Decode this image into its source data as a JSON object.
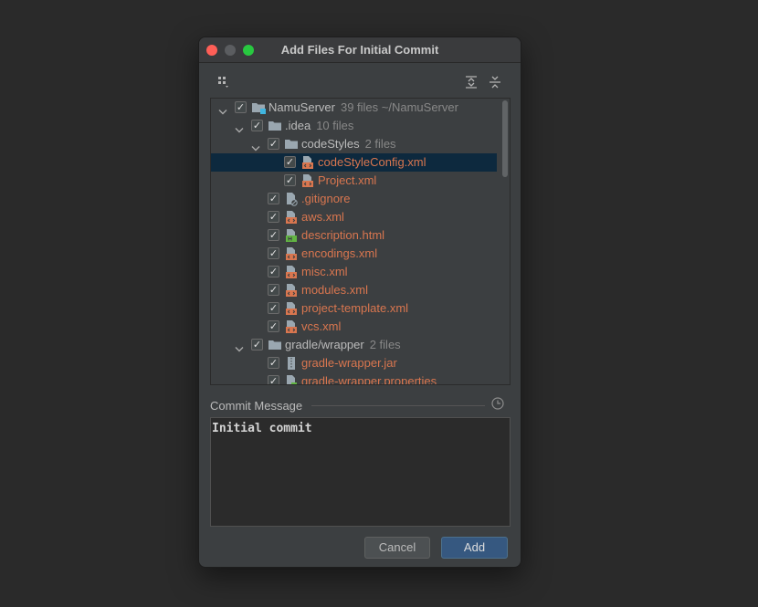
{
  "window": {
    "title": "Add Files For Initial Commit"
  },
  "toolbar": {
    "group_icon": "group-by-icon",
    "expand_icon": "expand-all-icon",
    "collapse_icon": "collapse-all-icon"
  },
  "tree": [
    {
      "name": "NamuServer",
      "meta": "39 files  ~/NamuServer",
      "kind": "module",
      "depth": 0,
      "expanded": true,
      "checked": true
    },
    {
      "name": ".idea",
      "meta": "10 files",
      "kind": "folder",
      "depth": 1,
      "expanded": true,
      "checked": true
    },
    {
      "name": "codeStyles",
      "meta": "2 files",
      "kind": "folder",
      "depth": 2,
      "expanded": true,
      "checked": true
    },
    {
      "name": "codeStyleConfig.xml",
      "kind": "xml",
      "depth": 3,
      "checked": true,
      "selected": true
    },
    {
      "name": "Project.xml",
      "kind": "xml",
      "depth": 3,
      "checked": true
    },
    {
      "name": ".gitignore",
      "kind": "ignore",
      "depth": 2,
      "checked": true
    },
    {
      "name": "aws.xml",
      "kind": "xml",
      "depth": 2,
      "checked": true
    },
    {
      "name": "description.html",
      "kind": "html",
      "depth": 2,
      "checked": true
    },
    {
      "name": "encodings.xml",
      "kind": "xml",
      "depth": 2,
      "checked": true
    },
    {
      "name": "misc.xml",
      "kind": "xml",
      "depth": 2,
      "checked": true
    },
    {
      "name": "modules.xml",
      "kind": "xml",
      "depth": 2,
      "checked": true
    },
    {
      "name": "project-template.xml",
      "kind": "xml",
      "depth": 2,
      "checked": true
    },
    {
      "name": "vcs.xml",
      "kind": "xml",
      "depth": 2,
      "checked": true
    },
    {
      "name": "gradle/wrapper",
      "meta": "2 files",
      "kind": "folder",
      "depth": 1,
      "expanded": true,
      "checked": true
    },
    {
      "name": "gradle-wrapper.jar",
      "kind": "jar",
      "depth": 2,
      "checked": true
    },
    {
      "name": "gradle-wrapper.properties",
      "kind": "properties",
      "depth": 2,
      "checked": true
    }
  ],
  "commit": {
    "label": "Commit Message",
    "message": "Initial commit",
    "history_icon": "clock-icon"
  },
  "buttons": {
    "cancel": "Cancel",
    "add": "Add"
  },
  "colors": {
    "new_file": "#d9764f",
    "selection": "#0d293e",
    "primary_button": "#365880"
  }
}
